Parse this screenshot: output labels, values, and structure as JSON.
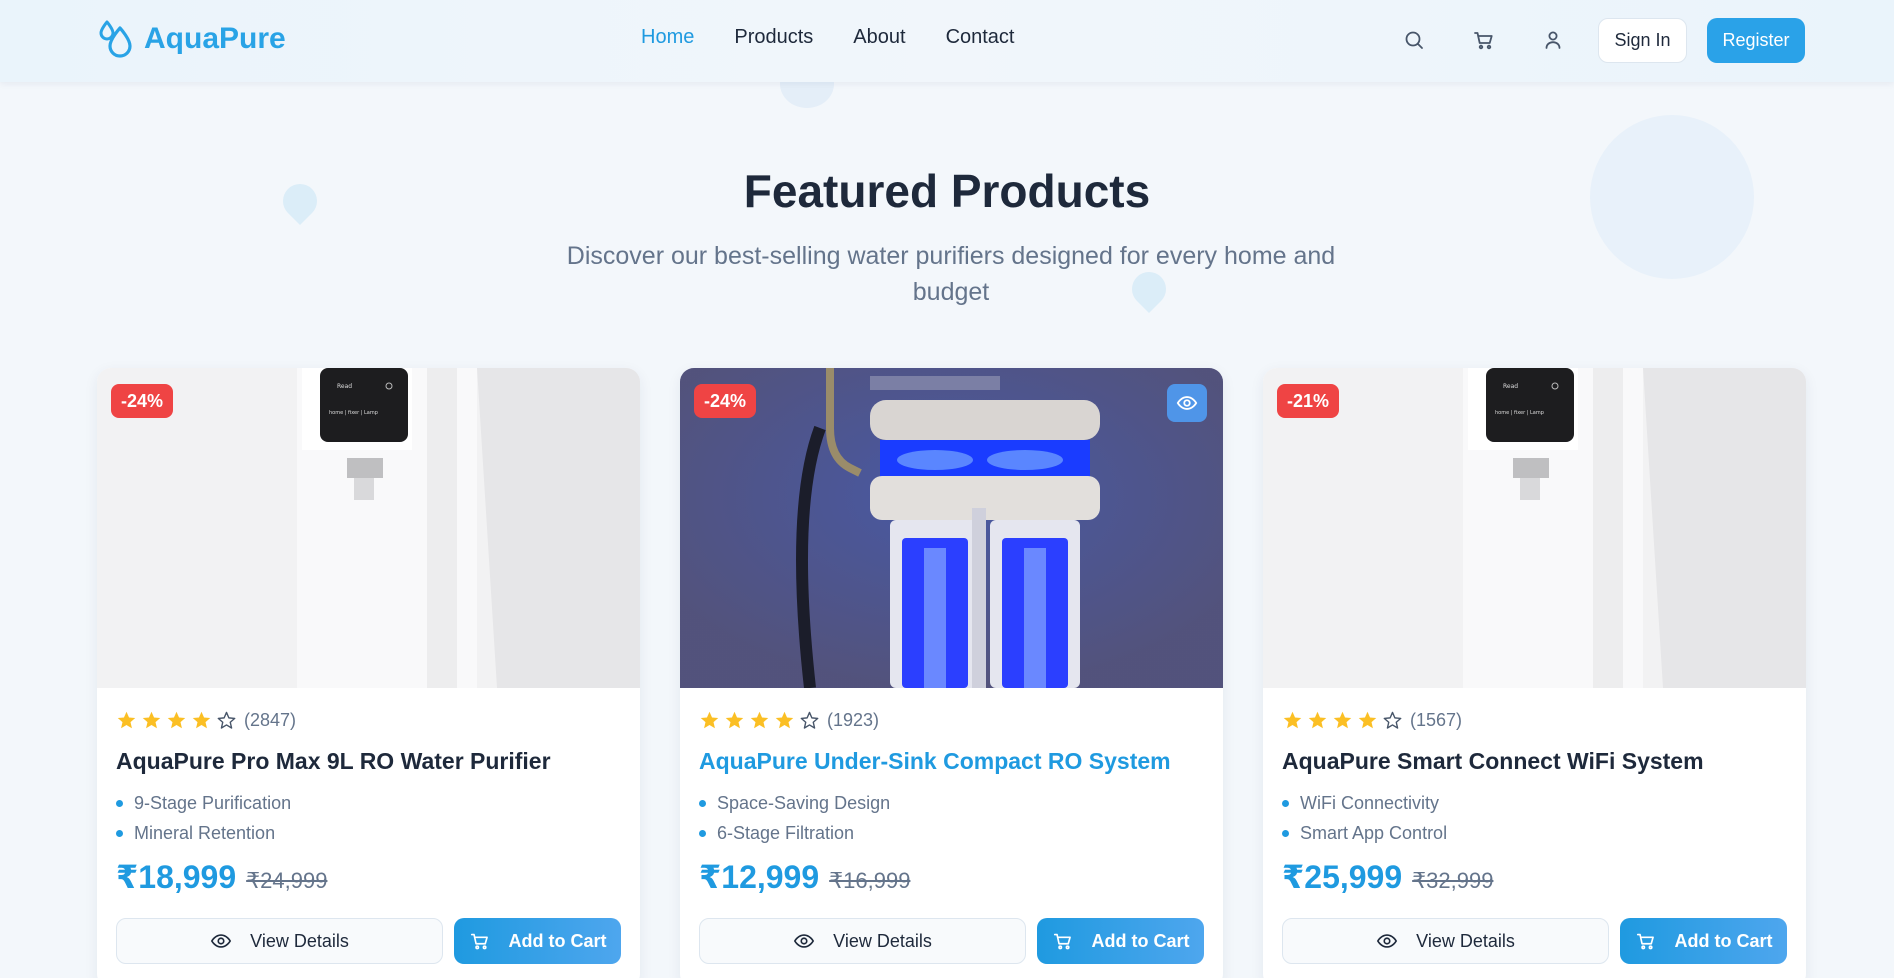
{
  "header": {
    "brand": "AquaPure",
    "nav": [
      {
        "label": "Home",
        "active": true
      },
      {
        "label": "Products",
        "active": false
      },
      {
        "label": "About",
        "active": false
      },
      {
        "label": "Contact",
        "active": false
      }
    ],
    "icons": [
      "search-icon",
      "cart-icon",
      "user-icon"
    ],
    "sign_in_label": "Sign In",
    "register_label": "Register"
  },
  "hero": {
    "title": "Featured Products",
    "subtitle": "Discover our best-selling water purifiers designed for every home and budget"
  },
  "colors": {
    "accent": "#1f9ae0",
    "discount_badge": "#ef4444",
    "star": "#fbbf24"
  },
  "products": [
    {
      "discount": "-24%",
      "rating": 4,
      "reviews": "(2847)",
      "name": "AquaPure Pro Max 9L RO Water Purifier",
      "features": [
        "9-Stage Purification",
        "Mineral Retention"
      ],
      "price": "₹18,999",
      "old_price": "₹24,999",
      "view_label": "View Details",
      "cart_label": "Add to Cart"
    },
    {
      "discount": "-24%",
      "rating": 4,
      "reviews": "(1923)",
      "name": "AquaPure Under-Sink Compact RO System",
      "features": [
        "Space-Saving Design",
        "6-Stage Filtration"
      ],
      "price": "₹12,999",
      "old_price": "₹16,999",
      "view_label": "View Details",
      "cart_label": "Add to Cart"
    },
    {
      "discount": "-21%",
      "rating": 4,
      "reviews": "(1567)",
      "name": "AquaPure Smart Connect WiFi System",
      "features": [
        "WiFi Connectivity",
        "Smart App Control"
      ],
      "price": "₹25,999",
      "old_price": "₹32,999",
      "view_label": "View Details",
      "cart_label": "Add to Cart"
    }
  ]
}
